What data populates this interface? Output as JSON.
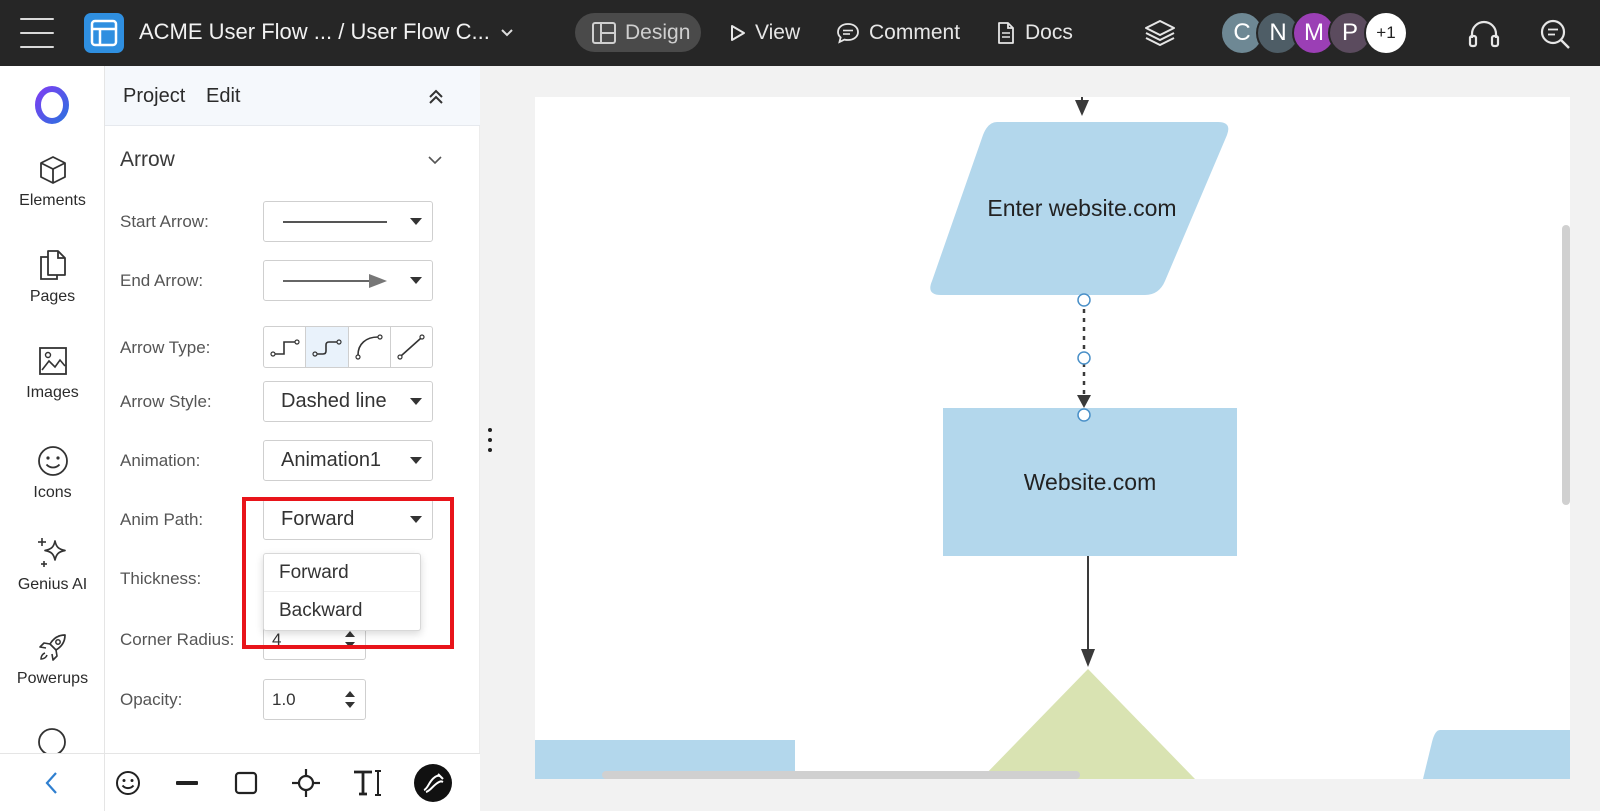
{
  "topbar": {
    "title": "ACME User Flow ... / User Flow C...",
    "modes": [
      {
        "label": "Design"
      },
      {
        "label": "View"
      },
      {
        "label": "Comment"
      },
      {
        "label": "Docs"
      }
    ],
    "avatars": [
      {
        "initial": "C",
        "color": "#6e8894"
      },
      {
        "initial": "N",
        "color": "#4e5d66"
      },
      {
        "initial": "M",
        "color": "#9b3fb5"
      },
      {
        "initial": "P",
        "color": "#5b4b5e"
      },
      {
        "initial": "+1",
        "color": "#ffffff"
      }
    ]
  },
  "rail": {
    "items": [
      {
        "label": "Elements",
        "icon": "cube-icon"
      },
      {
        "label": "Pages",
        "icon": "pages-icon"
      },
      {
        "label": "Images",
        "icon": "image-icon"
      },
      {
        "label": "Icons",
        "icon": "smiley-icon"
      },
      {
        "label": "Genius AI",
        "icon": "sparkle-icon"
      },
      {
        "label": "Powerups",
        "icon": "rocket-icon"
      }
    ]
  },
  "panel": {
    "tabs": [
      "Project",
      "Edit"
    ],
    "section_title": "Arrow",
    "labels": {
      "start_arrow": "Start Arrow:",
      "end_arrow": "End Arrow:",
      "arrow_type": "Arrow Type:",
      "arrow_style": "Arrow Style:",
      "animation": "Animation:",
      "anim_path": "Anim Path:",
      "thickness": "Thickness:",
      "corner_radius": "Corner Radius:",
      "opacity": "Opacity:"
    },
    "values": {
      "arrow_style": "Dashed line",
      "animation": "Animation1",
      "anim_path": "Forward",
      "corner_radius": "4",
      "opacity": "1.0"
    },
    "anim_path_options": [
      "Forward",
      "Backward"
    ],
    "selected_arrow_type": 1
  },
  "canvas": {
    "shapes": {
      "parallelogram": "Enter website.com",
      "rectangle": "Website.com"
    },
    "colors": {
      "blue_shape": "#b3d7ec",
      "green_shape": "#d9e3b2",
      "arrow": "#3a3a3a",
      "handle": "#4a90c8"
    }
  },
  "colors": {
    "highlight": "#e8141a",
    "topbar": "#262626"
  }
}
